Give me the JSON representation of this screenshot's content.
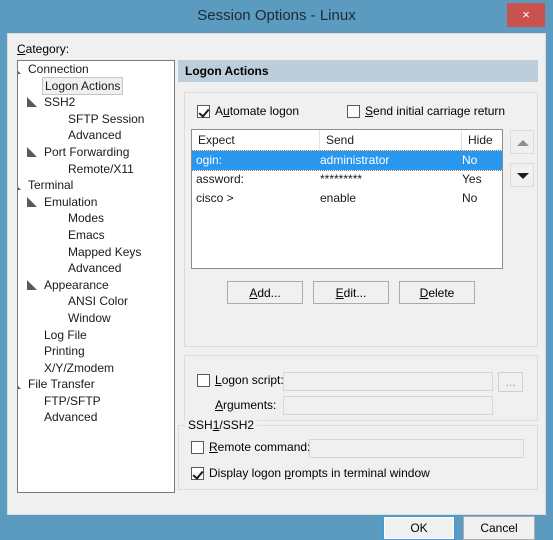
{
  "window": {
    "title": "Session Options - Linux",
    "close_label": "×",
    "frame_color": "#5b9bc0",
    "close_color": "#c9524f"
  },
  "left": {
    "category_label_pre": "C",
    "category_label_post": "ategory:",
    "tree": [
      {
        "label": "Connection",
        "indent": 0,
        "twisty": true,
        "selected": false
      },
      {
        "label": "Logon Actions",
        "indent": 1,
        "twisty": false,
        "selected": true
      },
      {
        "label": "SSH2",
        "indent": 1,
        "twisty": true,
        "selected": false
      },
      {
        "label": "SFTP Session",
        "indent": 2,
        "twisty": false,
        "selected": false
      },
      {
        "label": "Advanced",
        "indent": 2,
        "twisty": false,
        "selected": false
      },
      {
        "label": "Port Forwarding",
        "indent": 1,
        "twisty": true,
        "selected": false
      },
      {
        "label": "Remote/X11",
        "indent": 2,
        "twisty": false,
        "selected": false
      },
      {
        "label": "Terminal",
        "indent": 0,
        "twisty": true,
        "selected": false
      },
      {
        "label": "Emulation",
        "indent": 1,
        "twisty": true,
        "selected": false
      },
      {
        "label": "Modes",
        "indent": 2,
        "twisty": false,
        "selected": false
      },
      {
        "label": "Emacs",
        "indent": 2,
        "twisty": false,
        "selected": false
      },
      {
        "label": "Mapped Keys",
        "indent": 2,
        "twisty": false,
        "selected": false
      },
      {
        "label": "Advanced",
        "indent": 2,
        "twisty": false,
        "selected": false
      },
      {
        "label": "Appearance",
        "indent": 1,
        "twisty": true,
        "selected": false
      },
      {
        "label": "ANSI Color",
        "indent": 2,
        "twisty": false,
        "selected": false
      },
      {
        "label": "Window",
        "indent": 2,
        "twisty": false,
        "selected": false
      },
      {
        "label": "Log File",
        "indent": 1,
        "twisty": false,
        "selected": false
      },
      {
        "label": "Printing",
        "indent": 1,
        "twisty": false,
        "selected": false
      },
      {
        "label": "X/Y/Zmodem",
        "indent": 1,
        "twisty": false,
        "selected": false
      },
      {
        "label": "File Transfer",
        "indent": 0,
        "twisty": true,
        "selected": false
      },
      {
        "label": "FTP/SFTP",
        "indent": 1,
        "twisty": false,
        "selected": false
      },
      {
        "label": "Advanced",
        "indent": 1,
        "twisty": false,
        "selected": false
      }
    ]
  },
  "main": {
    "panel_title": "Logon Actions",
    "automate_logon": {
      "checked": true,
      "label_a": "A",
      "label_b": "u",
      "label_c": "tomate logon"
    },
    "send_initial_cr": {
      "checked": false,
      "label_a": "S",
      "label_b": "end initial carriage return"
    },
    "table": {
      "columns": [
        "Expect",
        "Send",
        "Hide"
      ],
      "rows": [
        {
          "expect": "ogin:",
          "send": "administrator",
          "hide": "No",
          "selected": true
        },
        {
          "expect": "assword:",
          "send": "*********",
          "hide": "Yes",
          "selected": false
        },
        {
          "expect": "cisco >",
          "send": "enable",
          "hide": "No",
          "selected": false
        }
      ]
    },
    "move_up": {
      "name": "move-up",
      "enabled": false
    },
    "move_down": {
      "name": "move-down",
      "enabled": true
    },
    "buttons": [
      {
        "pre": "A",
        "post": "dd...",
        "name": "add-button"
      },
      {
        "pre": "E",
        "post": "dit...",
        "name": "edit-button"
      },
      {
        "pre": "D",
        "post": "elete",
        "name": "delete-button"
      }
    ],
    "logon_script": {
      "checked": false,
      "label_a": "L",
      "label_b": "ogon script:",
      "value": "",
      "placeholder": "",
      "browse_label": "..."
    },
    "arguments": {
      "label_a": "A",
      "label_b": "rguments:",
      "value": "",
      "placeholder": ""
    },
    "ssh_group": {
      "legend_a": "SSH",
      "legend_b": "1",
      "legend_c": "/SSH2",
      "remote_command": {
        "checked": false,
        "label_a": "R",
        "label_b": "emote command:",
        "value": "",
        "placeholder": ""
      },
      "display_prompts": {
        "checked": true,
        "label_a": "Display logon ",
        "label_b": "p",
        "label_c": "rompts in terminal window"
      }
    }
  },
  "footer": {
    "ok_label": "OK",
    "cancel_label": "Cancel"
  }
}
